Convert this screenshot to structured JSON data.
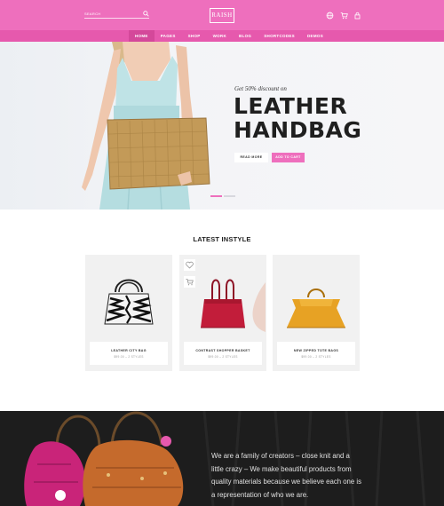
{
  "header": {
    "search_placeholder": "SEARCH",
    "logo_text": "RAISH",
    "icons": [
      "search-icon",
      "globe-icon",
      "cart-icon",
      "lock-icon"
    ],
    "accent_color": "#ee6fbd",
    "nav_color": "#e659ad"
  },
  "nav": {
    "items": [
      "HOME",
      "PAGES",
      "SHOP",
      "WORK",
      "BLOG",
      "SHORTCODES",
      "DEMOS"
    ],
    "active": "HOME"
  },
  "hero": {
    "eyebrow": "Get 50% discount on",
    "headline_line1": "LEATHER",
    "headline_line2": "HANDBAG",
    "read_more": "READ MORE",
    "add_to_cart": "ADD TO CART"
  },
  "latest": {
    "title": "LATEST INSTYLE",
    "products": [
      {
        "name": "LEATHER CITY BAG",
        "price": "$99.00 – 2 STYLES"
      },
      {
        "name": "CONTRAST SHOPPER BASKET",
        "price": "$99.00 – 2 STYLES"
      },
      {
        "name": "NEW ZIPPED TOTE BAGS",
        "price": "$99.00 – 2 STYLES"
      }
    ],
    "action_icons": [
      "heart-icon",
      "cart-icon"
    ]
  },
  "story": {
    "text": "We are a family of creators – close knit and a little crazy – We make beautiful products from quality materials because we believe each one is a representation of who we are."
  }
}
